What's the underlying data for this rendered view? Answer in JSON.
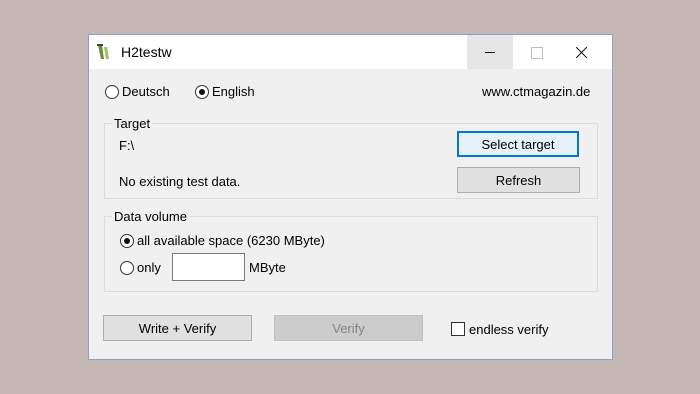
{
  "window": {
    "title": "H2testw"
  },
  "language": {
    "options": [
      "Deutsch",
      "English"
    ],
    "selected": "English",
    "website": "www.ctmagazin.de"
  },
  "target": {
    "group_label": "Target",
    "path": "F:\\",
    "status": "No existing test data.",
    "select_button": "Select target",
    "refresh_button": "Refresh"
  },
  "data_volume": {
    "group_label": "Data volume",
    "all_option": "all available space (6230 MByte)",
    "only_option": "only",
    "only_value": "",
    "unit": "MByte",
    "selected": "all"
  },
  "actions": {
    "write_verify": "Write + Verify",
    "verify": "Verify",
    "endless_verify": "endless verify",
    "endless_checked": false
  },
  "icons": {
    "app": "h2testw-app-icon",
    "minimize": "minimize-icon",
    "maximize": "maximize-icon",
    "close": "close-icon"
  }
}
